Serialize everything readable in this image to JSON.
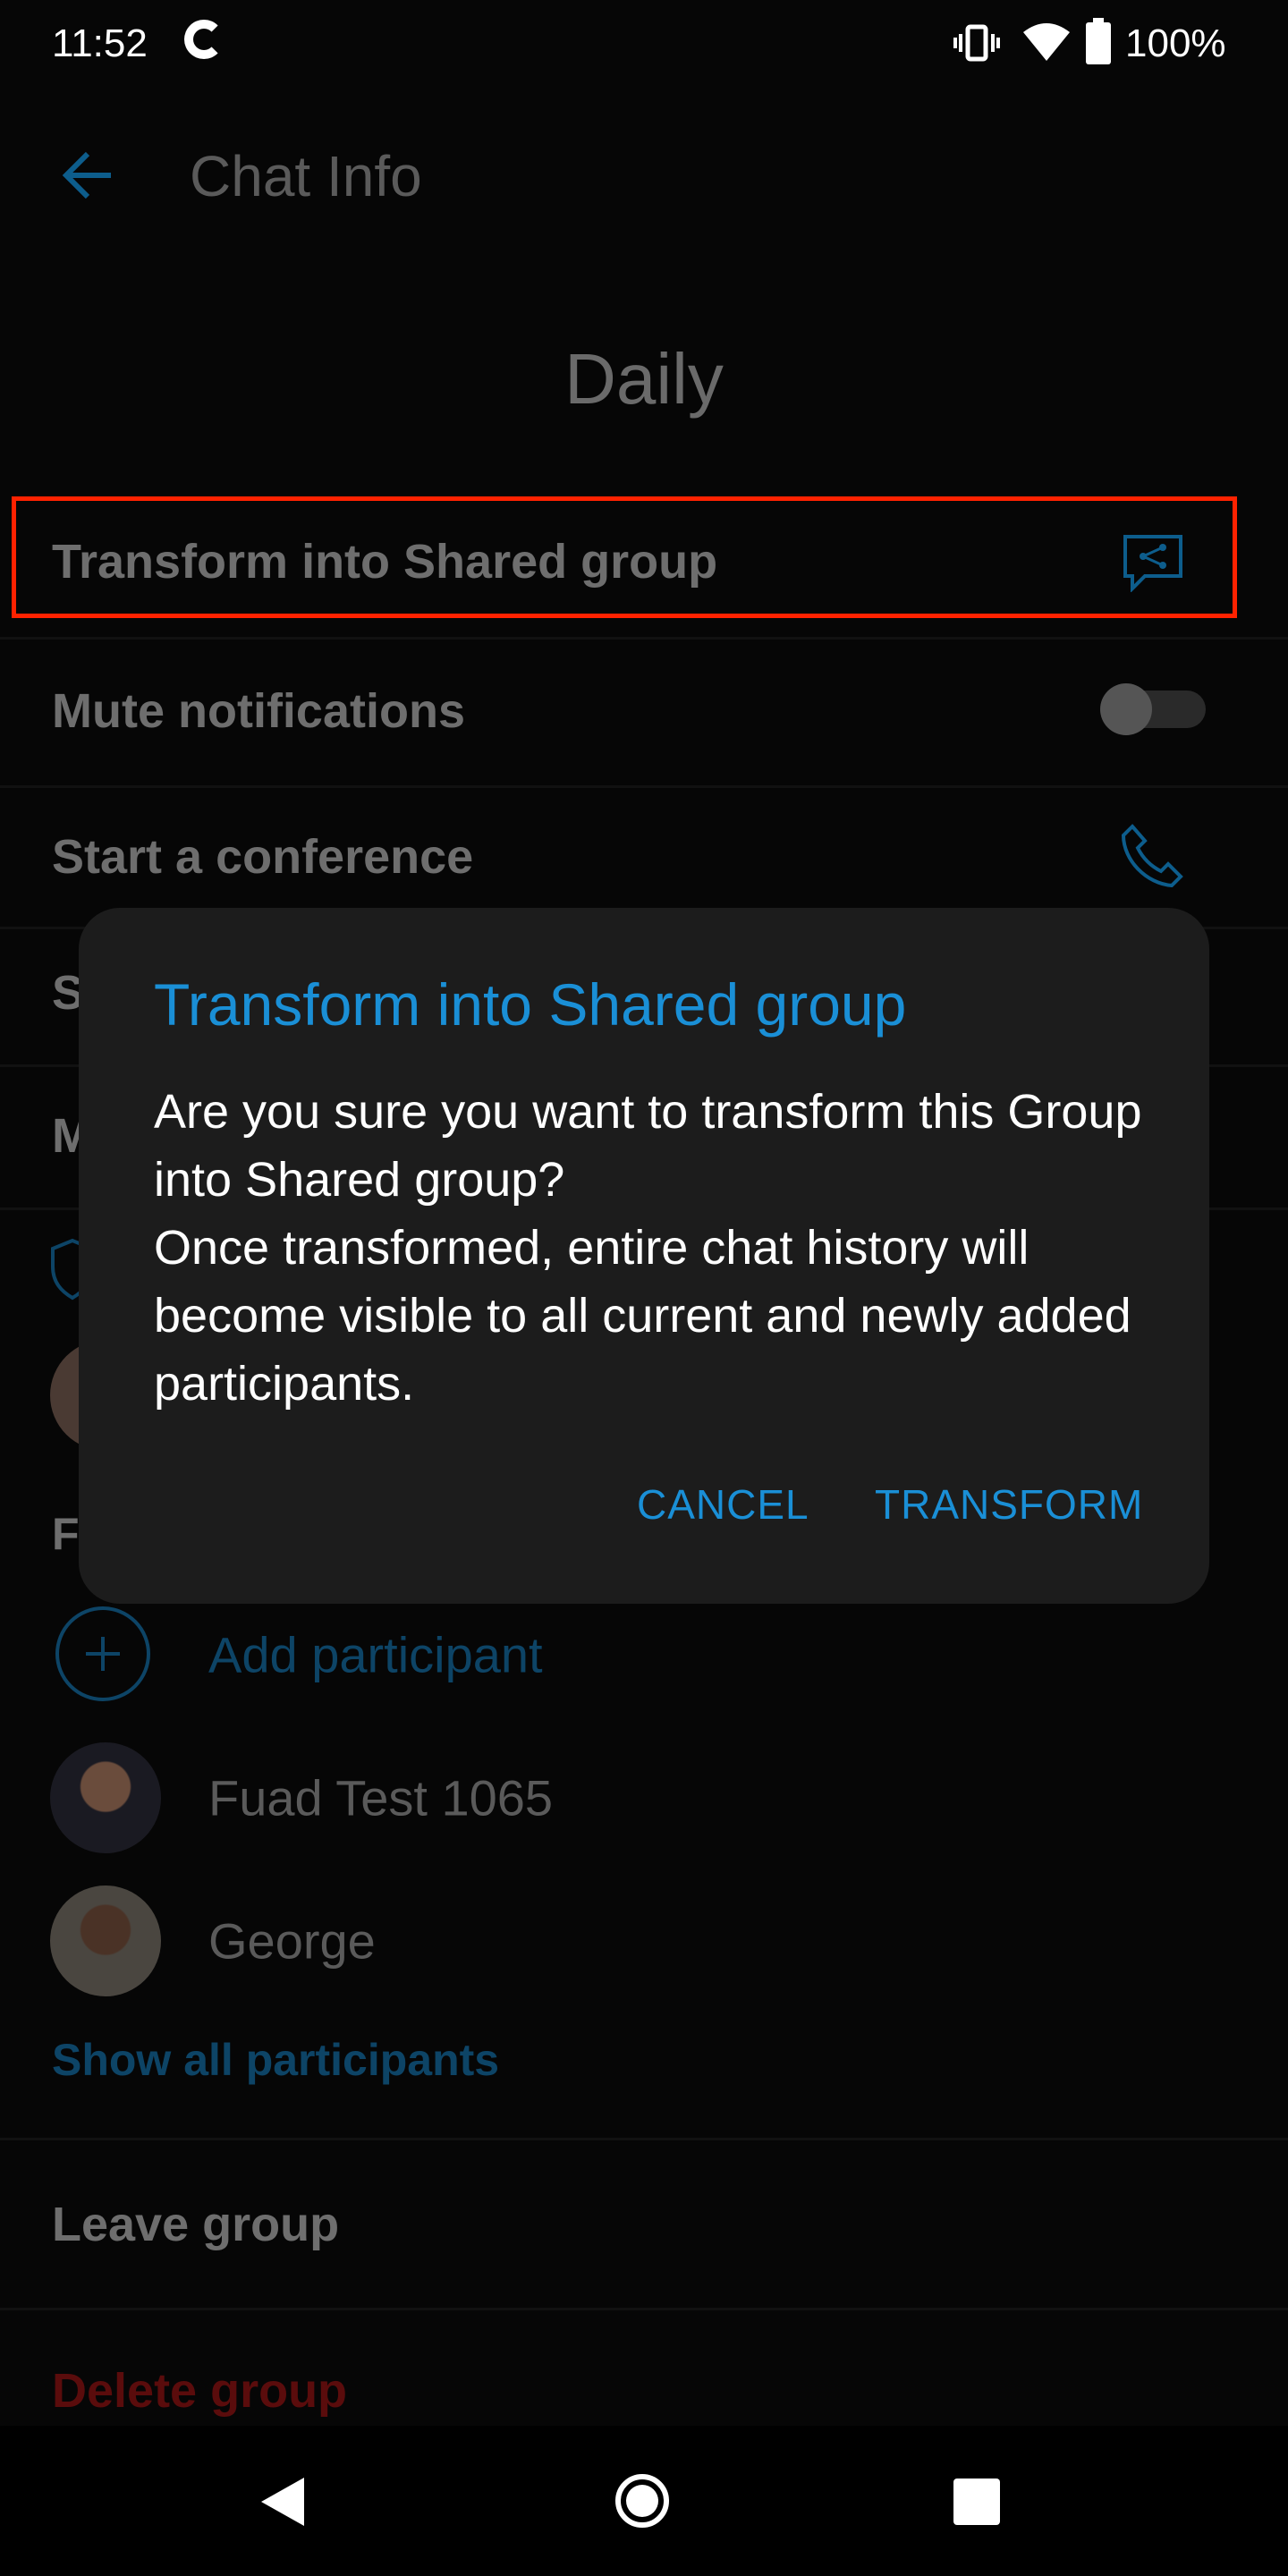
{
  "status_bar": {
    "time": "11:52",
    "battery": "100%",
    "icons": [
      "google-icon",
      "vibrate-icon",
      "wifi-icon",
      "battery-icon"
    ]
  },
  "header": {
    "title": "Chat Info",
    "back_icon": "arrow-left-icon"
  },
  "chat": {
    "name": "Daily"
  },
  "settings": {
    "transform": "Transform into Shared group",
    "mute": "Mute notifications",
    "mute_on": false,
    "conference": "Start a conference",
    "row4_partial": "S",
    "row5_partial": "M",
    "section_partial": "F"
  },
  "dialog": {
    "title": "Transform into Shared group",
    "body_line1": "Are you sure you want to transform this Group into Shared group?",
    "body_line2": "Once transformed, entire chat history will become visible to all current and newly added participants.",
    "cancel": "CANCEL",
    "confirm": "TRANSFORM"
  },
  "participants": {
    "add": "Add participant",
    "items": [
      {
        "name": "Fuad Test 1065"
      },
      {
        "name": "George"
      }
    ],
    "show_all": "Show all participants"
  },
  "actions": {
    "leave": "Leave group",
    "delete": "Delete group"
  },
  "colors": {
    "accent": "#1a8fd6",
    "highlight_box": "#ff2200",
    "danger": "#6e0c0c"
  }
}
